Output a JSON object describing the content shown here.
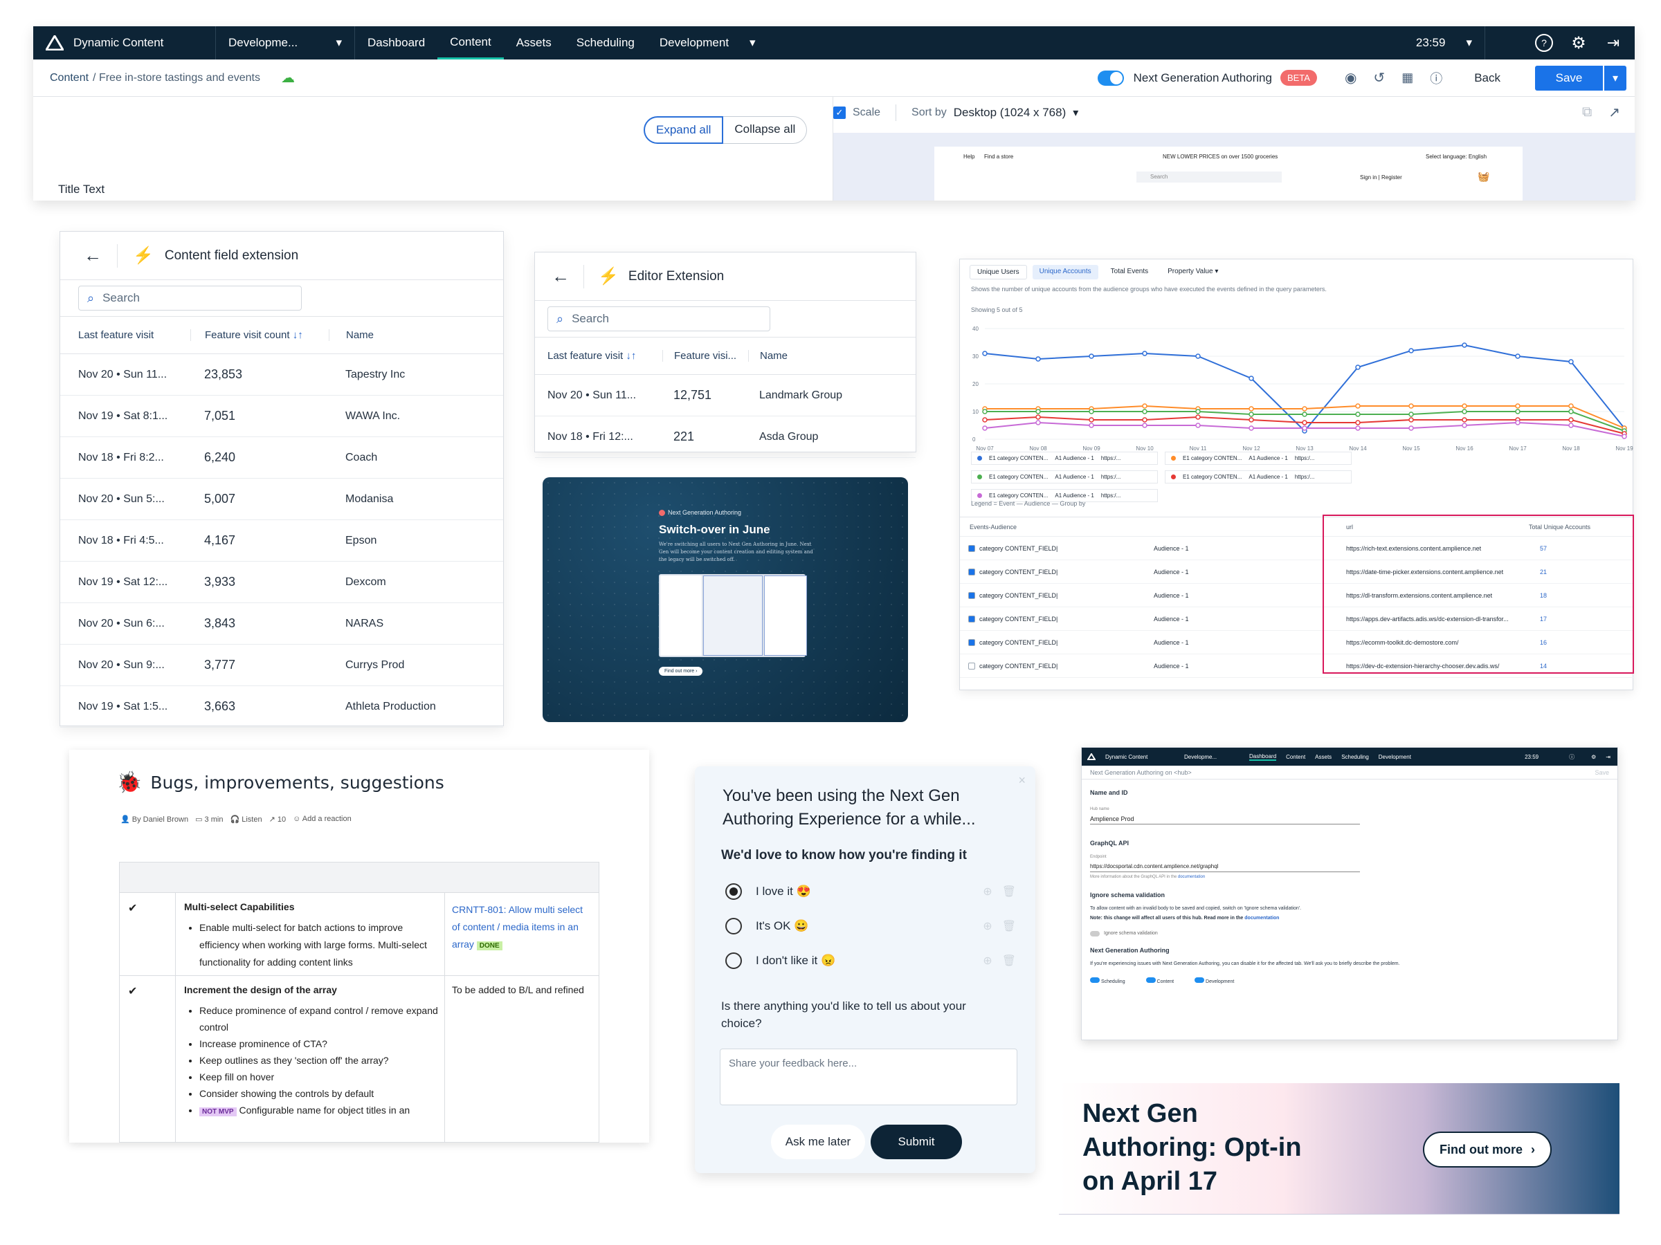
{
  "nav": {
    "brand": "Dynamic Content",
    "hub": "Developme...",
    "items": [
      "Dashboard",
      "Content",
      "Assets",
      "Scheduling",
      "Development"
    ],
    "active": "Content",
    "time": "23:59"
  },
  "toolbar": {
    "breadcrumb_root": "Content",
    "breadcrumb_item": "/ Free in-store tastings and events",
    "ng_label": "Next Generation Authoring",
    "beta": "BETA",
    "back": "Back",
    "save": "Save"
  },
  "editor": {
    "expand_all": "Expand all",
    "collapse_all": "Collapse all",
    "title_text": "Title Text",
    "scale": "Scale",
    "sort_by": "Sort by",
    "device": "Desktop (1024 x 768)"
  },
  "preview": {
    "help": "Help",
    "find_store": "Find a store",
    "promo": "NEW LOWER PRICES on over 1500 groceries",
    "language": "Select language: English",
    "search": "Search",
    "signin": "Sign in | Register"
  },
  "cfe": {
    "title": "Content field extension",
    "search": "Search",
    "col1": "Last feature visit",
    "col2": "Feature visit count",
    "col3": "Name",
    "rows": [
      [
        "Nov 20 • Sun 11...",
        "23,853",
        "Tapestry Inc"
      ],
      [
        "Nov 19 • Sat 8:1...",
        "7,051",
        "WAWA Inc."
      ],
      [
        "Nov 18 • Fri 8:2...",
        "6,240",
        "Coach"
      ],
      [
        "Nov 20 • Sun 5:...",
        "5,007",
        "Modanisa"
      ],
      [
        "Nov 18 • Fri 4:5...",
        "4,167",
        "Epson"
      ],
      [
        "Nov 19 • Sat 12:...",
        "3,933",
        "Dexcom"
      ],
      [
        "Nov 20 • Sun 6:...",
        "3,843",
        "NARAS"
      ],
      [
        "Nov 20 • Sun 9:...",
        "3,777",
        "Currys Prod"
      ],
      [
        "Nov 19 • Sat 1:5...",
        "3,663",
        "Athleta Production"
      ]
    ]
  },
  "ee": {
    "title": "Editor Extension",
    "search": "Search",
    "col1": "Last feature visit",
    "col2": "Feature visi...",
    "col3": "Name",
    "rows": [
      [
        "Nov 20 • Sun 11...",
        "12,751",
        "Landmark Group"
      ],
      [
        "Nov 18 • Fri 12:...",
        "221",
        "Asda Group"
      ]
    ]
  },
  "promo": {
    "tag": "Next Generation Authoring",
    "title": "Switch-over in June",
    "body": "We're switching all users to Next Gen Authoring in June. Next Gen will become your content creation and editing system and the legacy will be switched off.",
    "cta": "Find out more"
  },
  "dash": {
    "tabs": [
      "Unique Users",
      "Unique Accounts",
      "Total Events",
      "Property Value"
    ],
    "desc": "Shows the number of unique accounts from the audience groups who have executed the events defined in the query parameters.",
    "showing": "Showing 5 out of 5",
    "legend": [
      [
        "E1 category CONTEN...",
        "A1 Audience - 1",
        "https:/..."
      ],
      [
        "E1 category CONTEN...",
        "A1 Audience - 1",
        "https:/..."
      ],
      [
        "E1 category CONTEN...",
        "A1 Audience - 1",
        "https:/..."
      ],
      [
        "E1 category CONTEN...",
        "A1 Audience - 1",
        "https:/..."
      ],
      [
        "E1 category CONTEN...",
        "A1 Audience - 1",
        "https:/..."
      ]
    ],
    "legend_note": "Legend = Event — Audience — Group by",
    "table_head": [
      "Events-Audience",
      "",
      "url",
      "Total Unique Accounts"
    ],
    "table": [
      [
        "category CONTENT_FIELD|",
        "Audience - 1",
        "https://rich-text.extensions.content.amplience.net",
        "57"
      ],
      [
        "category CONTENT_FIELD|",
        "Audience - 1",
        "https://date-time-picker.extensions.content.amplience.net",
        "21"
      ],
      [
        "category CONTENT_FIELD|",
        "Audience - 1",
        "https://dl-transform.extensions.content.amplience.net",
        "18"
      ],
      [
        "category CONTENT_FIELD|",
        "Audience - 1",
        "https://apps.dev-artifacts.adis.ws/dc-extension-dl-transfor...",
        "17"
      ],
      [
        "category CONTENT_FIELD|",
        "Audience - 1",
        "https://ecomm-toolkit.dc-demostore.com/",
        "16"
      ],
      [
        "category CONTENT_FIELD|",
        "Audience - 1",
        "https://dev-dc-extension-hierarchy-chooser.dev.adis.ws/",
        "14"
      ]
    ]
  },
  "chart_data": {
    "type": "line",
    "categories": [
      "Nov 07",
      "Nov 08",
      "Nov 09",
      "Nov 10",
      "Nov 11",
      "Nov 12",
      "Nov 13",
      "Nov 14",
      "Nov 15",
      "Nov 16",
      "Nov 17",
      "Nov 18",
      "Nov 19"
    ],
    "ylim": [
      0,
      40
    ],
    "yticks": [
      0,
      10,
      20,
      30,
      40
    ],
    "series": [
      {
        "color": "#2f6fd8",
        "values": [
          31,
          29,
          30,
          31,
          30,
          22,
          3,
          26,
          32,
          34,
          30,
          28,
          4
        ]
      },
      {
        "color": "#ff8c29",
        "values": [
          11,
          11,
          11,
          12,
          11,
          11,
          11,
          12,
          12,
          12,
          12,
          12,
          4
        ]
      },
      {
        "color": "#4caf50",
        "values": [
          10,
          10,
          10,
          10,
          10,
          9,
          9,
          9,
          9,
          10,
          10,
          10,
          3
        ]
      },
      {
        "color": "#e53935",
        "values": [
          7,
          8,
          7,
          7,
          8,
          7,
          6,
          6,
          7,
          7,
          7,
          7,
          2
        ]
      },
      {
        "color": "#c76ad6",
        "values": [
          4,
          6,
          5,
          5,
          5,
          4,
          4,
          4,
          4,
          5,
          6,
          5,
          1
        ]
      }
    ]
  },
  "bugs": {
    "title": "Bugs, improvements, suggestions",
    "meta": [
      "By Daniel Brown",
      "3 min",
      "Listen",
      "10",
      "Add a reaction"
    ],
    "row1_title": "Multi-select Capabilities",
    "row1_items": [
      "Enable multi-select for batch actions to improve efficiency when working with large forms. Multi-select functionality for adding content links"
    ],
    "row1_ticket": "CRNTT-801: Allow multi select of content / media items in an array",
    "row1_status": "DONE",
    "row2_title": "Increment the design of the array",
    "row2_items": [
      "Reduce prominence of expand control / remove expand control",
      "Increase prominence of CTA?",
      "Keep outlines as they 'section off' the array?",
      "Keep fill on hover",
      "Consider showing the controls by default"
    ],
    "row2_last_tag": "NOT MVP",
    "row2_last": "Configurable name for object titles in an",
    "row2_note": "To be added to B/L and refined",
    "check": "✔"
  },
  "survey": {
    "title": "You've been using the Next Gen Authoring Experience for a while...",
    "question": "We'd love to know how you're finding it",
    "options": [
      "I love it 😍",
      "It's OK 😀",
      "I don't like it 😠"
    ],
    "followup": "Is there anything you'd like to tell us about your choice?",
    "placeholder": "Share your feedback here...",
    "later": "Ask me later",
    "submit": "Submit"
  },
  "settings": {
    "nav_brand": "Dynamic Content",
    "nav_hub": "Developme...",
    "nav_items": [
      "Dashboard",
      "Content",
      "Assets",
      "Scheduling",
      "Development"
    ],
    "time": "23:59",
    "crumb": "Next Generation Authoring on <hub>",
    "save": "Save",
    "name_id": "Name and ID",
    "hub_label": "Hub name",
    "hub_value": "Amplience Prod",
    "graphql": "GraphQL API",
    "endpoint_label": "Endpoint",
    "endpoint": "https://docsportal.cdn.content.amplience.net/graphql",
    "endpoint_help": "More information about the GraphQL API in the",
    "doc_link": "documentation",
    "schema_title": "Ignore schema validation",
    "schema_text": "To allow content with an invalid body to be saved and copied, switch on 'Ignore schema validation'.",
    "schema_note": "Note: this change will affect all users of this hub. Read more in the",
    "schema_toggle": "Ignore schema validation",
    "ng_title": "Next Generation Authoring",
    "ng_text": "If you're experiencing issues with Next Generation Authoring, you can disable it for the affected tab. We'll ask you to briefly describe the problem.",
    "toggles": [
      "Scheduling",
      "Content",
      "Development"
    ]
  },
  "optin": {
    "title": "Next Gen Authoring: Opt-in on April 17",
    "cta": "Find out more"
  }
}
